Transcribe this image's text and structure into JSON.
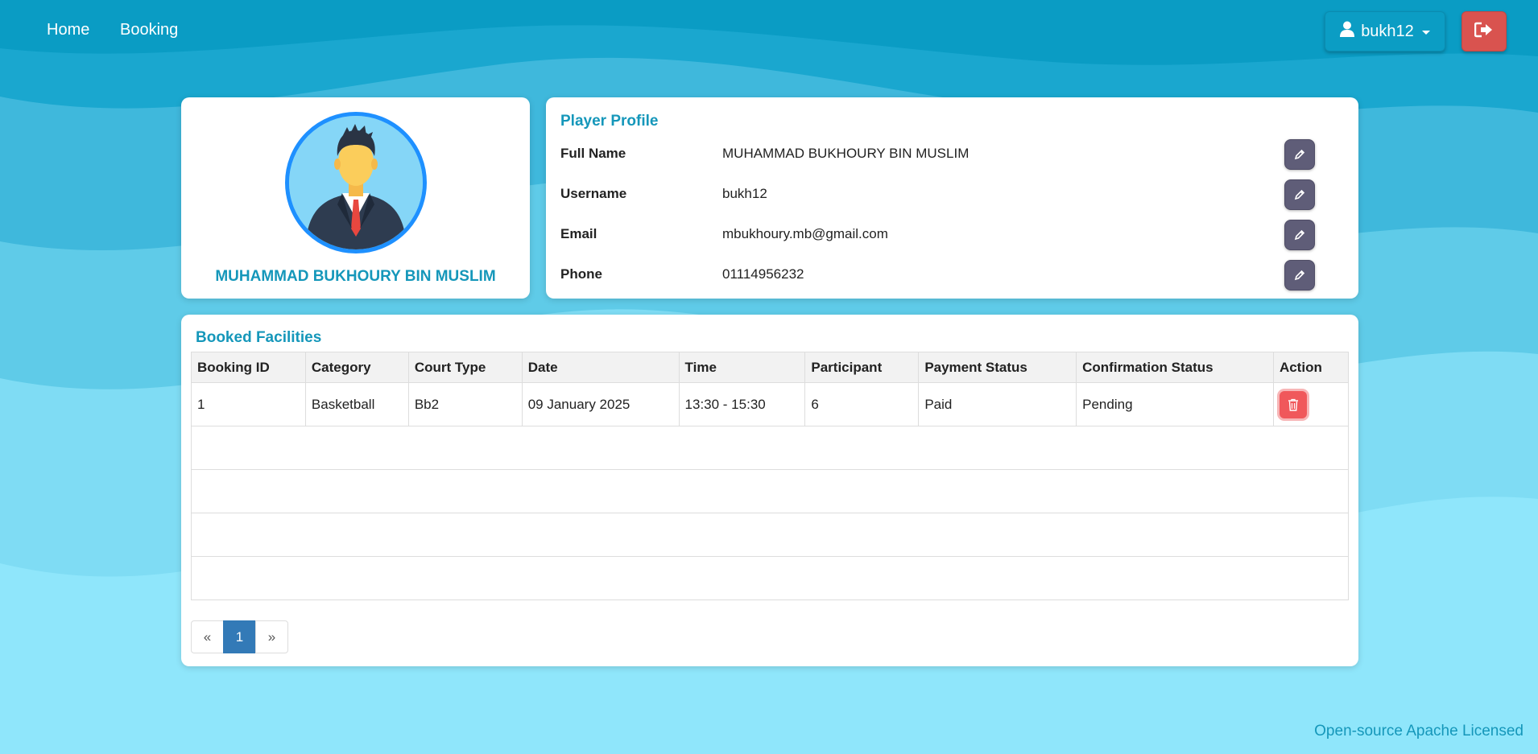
{
  "nav": {
    "home": "Home",
    "booking": "Booking",
    "user_label": "bukh12"
  },
  "profile_card": {
    "name": "MUHAMMAD BUKHOURY BIN MUSLIM"
  },
  "player_profile": {
    "title": "Player Profile",
    "fields": [
      {
        "label": "Full Name",
        "value": "MUHAMMAD BUKHOURY BIN MUSLIM"
      },
      {
        "label": "Username",
        "value": "bukh12"
      },
      {
        "label": "Email",
        "value": "mbukhoury.mb@gmail.com"
      },
      {
        "label": "Phone",
        "value": "01114956232"
      }
    ]
  },
  "booked_facilities": {
    "title": "Booked Facilities",
    "columns": [
      "Booking ID",
      "Category",
      "Court Type",
      "Date",
      "Time",
      "Participant",
      "Payment Status",
      "Confirmation Status",
      "Action"
    ],
    "rows": [
      [
        "1",
        "Basketball",
        "Bb2",
        "09 January 2025",
        "13:30 - 15:30",
        "6",
        "Paid",
        "Pending"
      ]
    ],
    "pagination": {
      "prev": "«",
      "current": "1",
      "next": "»"
    }
  },
  "footer": "Open-source Apache Licensed",
  "colors": {
    "accent": "#1597ba",
    "danger": "#d9534f",
    "edit_button": "#5f5d78",
    "page_active": "#337ab7"
  },
  "icons": [
    "user-icon",
    "logout-icon",
    "pencil-icon",
    "trash-icon"
  ]
}
